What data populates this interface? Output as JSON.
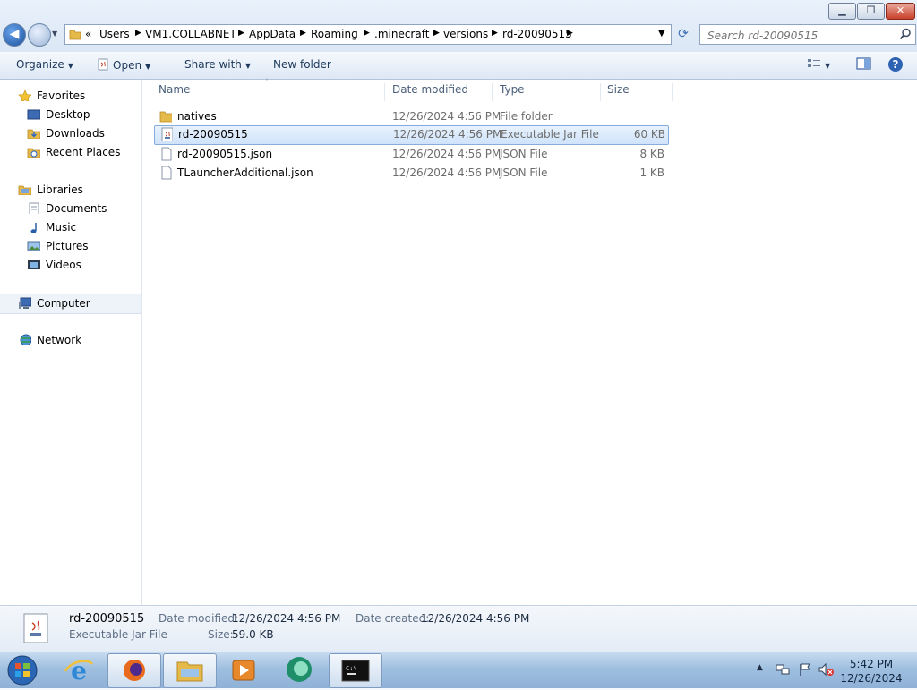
{
  "window": {
    "controls": [
      "minimize",
      "maximize",
      "close"
    ]
  },
  "address": {
    "overflow": "«",
    "crumbs": [
      "Users",
      "VM1.COLLABNET",
      "AppData",
      "Roaming",
      ".minecraft",
      "versions",
      "rd-20090515"
    ]
  },
  "search": {
    "placeholder": "Search rd-20090515"
  },
  "toolbar": {
    "organize": "Organize",
    "open": "Open",
    "share_with": "Share with",
    "new_folder": "New folder"
  },
  "nav": {
    "favorites": "Favorites",
    "desktop": "Desktop",
    "downloads": "Downloads",
    "recent_places": "Recent Places",
    "libraries": "Libraries",
    "documents": "Documents",
    "music": "Music",
    "pictures": "Pictures",
    "videos": "Videos",
    "computer": "Computer",
    "network": "Network"
  },
  "columns": {
    "name": "Name",
    "date": "Date modified",
    "type": "Type",
    "size": "Size"
  },
  "files": [
    {
      "name": "natives",
      "date": "12/26/2024 4:56 PM",
      "type": "File folder",
      "size": "",
      "icon": "folder-icon"
    },
    {
      "name": "rd-20090515",
      "date": "12/26/2024 4:56 PM",
      "type": "Executable Jar File",
      "size": "60 KB",
      "icon": "jar-file-icon",
      "selected": true
    },
    {
      "name": "rd-20090515.json",
      "date": "12/26/2024 4:56 PM",
      "type": "JSON File",
      "size": "8 KB",
      "icon": "file-icon"
    },
    {
      "name": "TLauncherAdditional.json",
      "date": "12/26/2024 4:56 PM",
      "type": "JSON File",
      "size": "1 KB",
      "icon": "file-icon"
    }
  ],
  "details": {
    "name": "rd-20090515",
    "type": "Executable Jar File",
    "date_modified_label": "Date modified:",
    "date_modified": "12/26/2024 4:56 PM",
    "date_created_label": "Date created:",
    "date_created": "12/26/2024 4:56 PM",
    "size_label": "Size:",
    "size": "59.0 KB"
  },
  "taskbar": {
    "apps": [
      "start-orb",
      "internet-explorer",
      "firefox",
      "windows-explorer",
      "media-player",
      "app-circle",
      "command-prompt"
    ],
    "time": "5:42 PM",
    "date": "12/26/2024"
  },
  "colors": {
    "selection": "#cfe3fa",
    "selection_border": "#84acdd",
    "accent": "#1e395b"
  }
}
